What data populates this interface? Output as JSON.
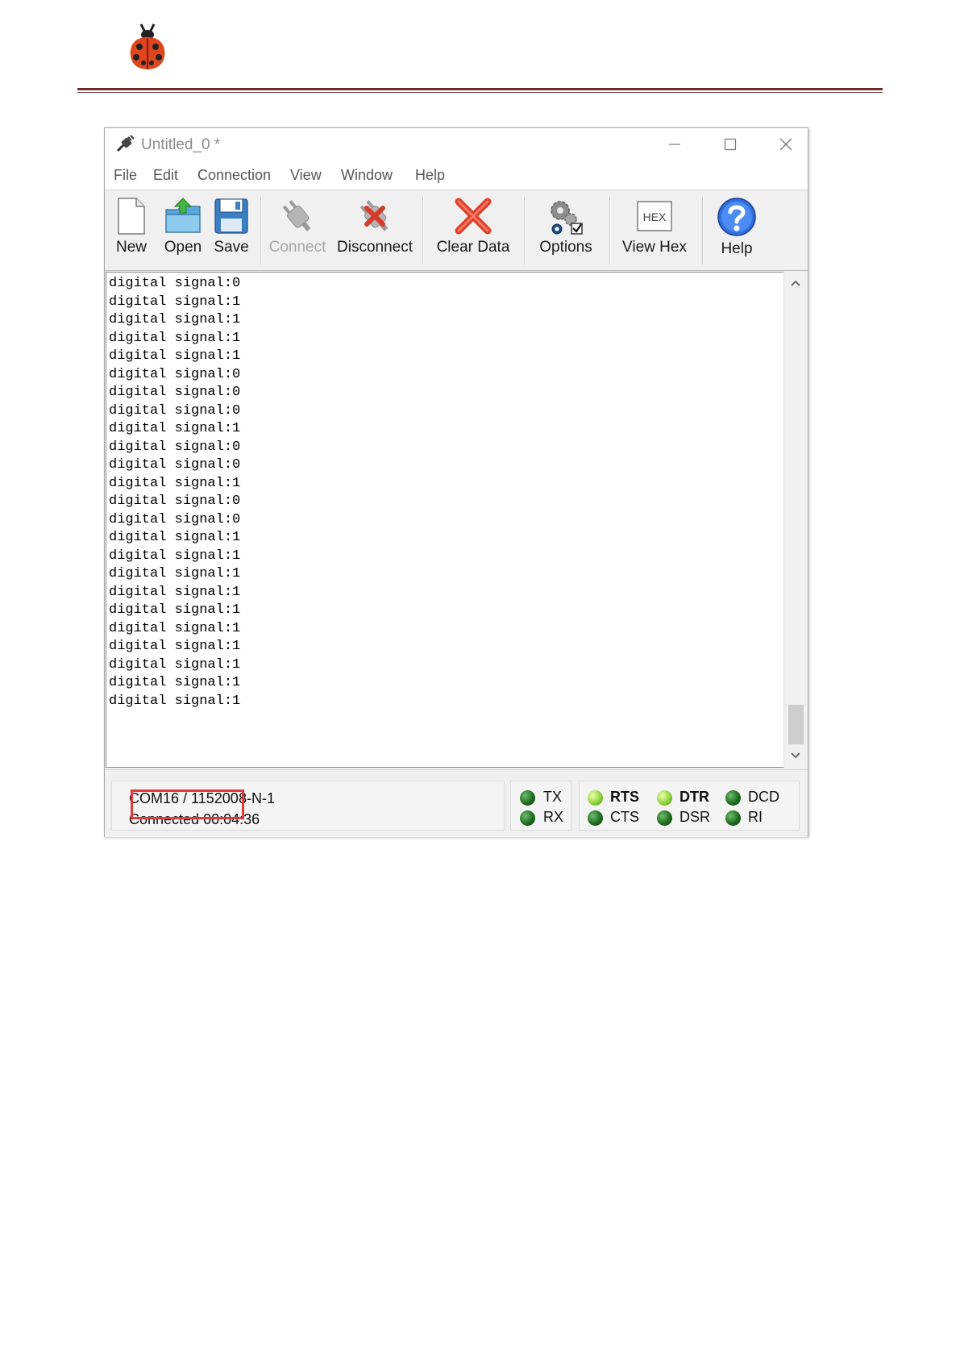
{
  "window": {
    "title": "Untitled_0 *"
  },
  "menu": [
    "File",
    "Edit",
    "Connection",
    "View",
    "Window",
    "Help"
  ],
  "toolbar": {
    "new": "New",
    "open": "Open",
    "save": "Save",
    "connect": "Connect",
    "disconnect": "Disconnect",
    "clear_data": "Clear Data",
    "options": "Options",
    "view_hex": "View Hex",
    "hex_icon_text": "HEX",
    "help": "Help"
  },
  "terminal": {
    "lines": [
      "digital signal:0",
      "digital signal:1",
      "digital signal:1",
      "digital signal:1",
      "digital signal:1",
      "digital signal:0",
      "digital signal:0",
      "digital signal:0",
      "digital signal:1",
      "digital signal:0",
      "digital signal:0",
      "digital signal:1",
      "digital signal:0",
      "digital signal:0",
      "digital signal:1",
      "digital signal:1",
      "digital signal:1",
      "digital signal:1",
      "digital signal:1",
      "digital signal:1",
      "digital signal:1",
      "digital signal:1",
      "digital signal:1",
      "digital signal:1"
    ]
  },
  "status": {
    "port_baud": "COM16 / 115200",
    "format": "8-N-1",
    "connection": "Connected 00:04:36",
    "leds": {
      "tx": "TX",
      "rx": "RX",
      "rts": "RTS",
      "cts": "CTS",
      "dtr": "DTR",
      "dsr": "DSR",
      "dcd": "DCD",
      "ri": "RI"
    }
  },
  "colors": {
    "highlight_box": "#e03a3a",
    "header_rule": "#6b2b2b",
    "led_green": "#1f6b1f"
  }
}
